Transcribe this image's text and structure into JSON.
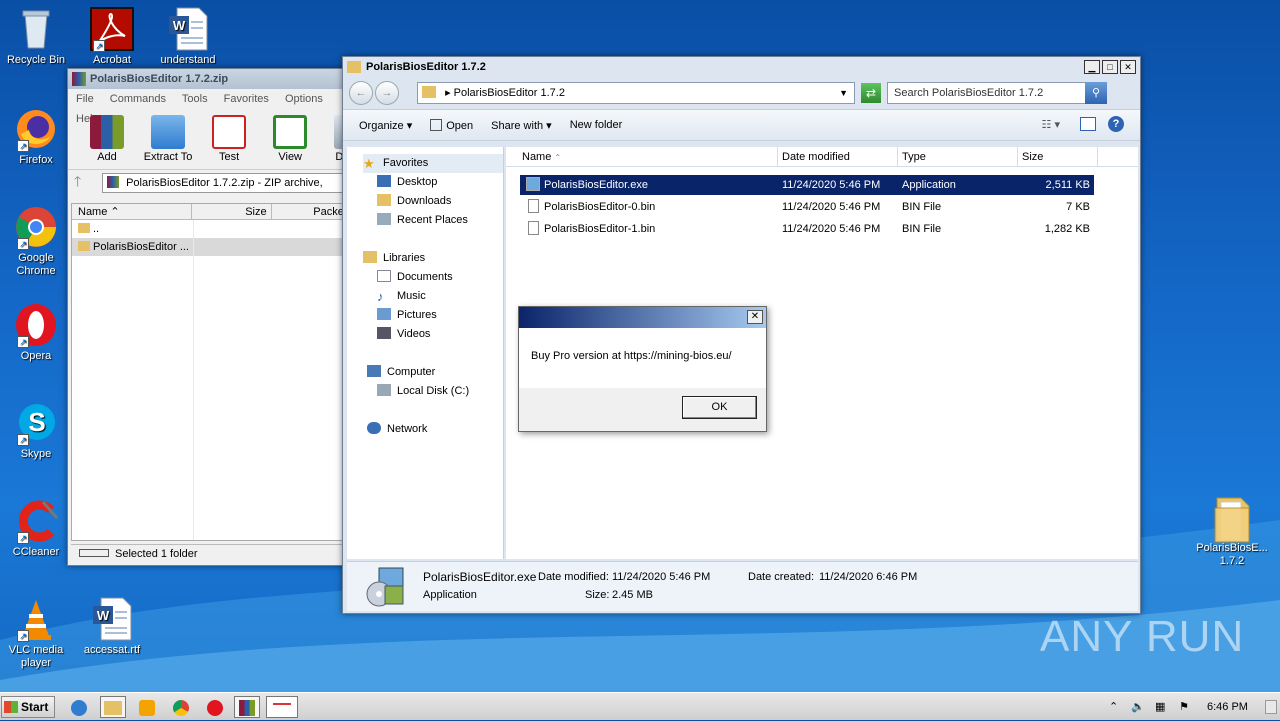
{
  "desktop": {
    "icons_left": [
      {
        "label": "Recycle Bin",
        "icon": "recycle-bin-icon"
      },
      {
        "label": "Firefox",
        "icon": "firefox-icon"
      },
      {
        "label": "Google Chrome",
        "icon": "chrome-icon"
      },
      {
        "label": "Opera",
        "icon": "opera-icon"
      },
      {
        "label": "Skype",
        "icon": "skype-icon"
      },
      {
        "label": "CCleaner",
        "icon": "ccleaner-icon"
      },
      {
        "label": "VLC media player",
        "icon": "vlc-icon"
      }
    ],
    "icons_top": [
      {
        "label": "Acrobat",
        "icon": "acrobat-icon"
      },
      {
        "label": "understand",
        "icon": "word-doc-icon"
      }
    ],
    "icon_accessat": {
      "label": "accessat.rtf",
      "icon": "word-doc-icon"
    },
    "icon_right": {
      "label": "PolarisBiosE... 1.7.2",
      "icon": "folder-icon"
    },
    "watermark": "ANY RUN"
  },
  "winrar": {
    "title": "PolarisBiosEditor 1.7.2.zip",
    "menu": [
      "File",
      "Commands",
      "Tools",
      "Favorites",
      "Options",
      "Help"
    ],
    "toolbar": [
      {
        "label": "Add",
        "icon": "add-icon"
      },
      {
        "label": "Extract To",
        "icon": "extract-icon"
      },
      {
        "label": "Test",
        "icon": "test-icon"
      },
      {
        "label": "View",
        "icon": "view-icon"
      },
      {
        "label": "Delete",
        "icon": "delete-icon"
      }
    ],
    "path": "PolarisBiosEditor 1.7.2.zip - ZIP archive,",
    "columns": [
      "Name",
      "Size",
      "Packed"
    ],
    "rows": [
      "..",
      "PolarisBiosEditor ..."
    ],
    "status": "Selected 1 folder"
  },
  "explorer": {
    "title": "PolarisBiosEditor 1.7.2",
    "address": "PolarisBiosEditor 1.7.2",
    "search_placeholder": "Search PolarisBiosEditor 1.7.2",
    "commands": {
      "organize": "Organize",
      "open": "Open",
      "share": "Share with",
      "new_folder": "New folder"
    },
    "nav": {
      "favorites": "Favorites",
      "desktop": "Desktop",
      "downloads": "Downloads",
      "recent": "Recent Places",
      "libraries": "Libraries",
      "documents": "Documents",
      "music": "Music",
      "pictures": "Pictures",
      "videos": "Videos",
      "computer": "Computer",
      "local_disk": "Local Disk (C:)",
      "network": "Network"
    },
    "columns": {
      "name": "Name",
      "modified": "Date modified",
      "type": "Type",
      "size": "Size"
    },
    "files": [
      {
        "name": "PolarisBiosEditor.exe",
        "modified": "11/24/2020 5:46 PM",
        "type": "Application",
        "size": "2,511 KB"
      },
      {
        "name": "PolarisBiosEditor-0.bin",
        "modified": "11/24/2020 5:46 PM",
        "type": "BIN File",
        "size": "7 KB"
      },
      {
        "name": "PolarisBiosEditor-1.bin",
        "modified": "11/24/2020 5:46 PM",
        "type": "BIN File",
        "size": "1,282 KB"
      }
    ],
    "details": {
      "name": "PolarisBiosEditor.exe",
      "kind": "Application",
      "modified_label": "Date modified:",
      "modified": "11/24/2020 5:46 PM",
      "created_label": "Date created:",
      "created": "11/24/2020 6:46 PM",
      "size_label": "Size:",
      "size": "2.45 MB"
    }
  },
  "dialog": {
    "message": "Buy Pro version at https://mining-bios.eu/",
    "ok": "OK"
  },
  "taskbar": {
    "start": "Start",
    "clock": "6:46 PM"
  }
}
